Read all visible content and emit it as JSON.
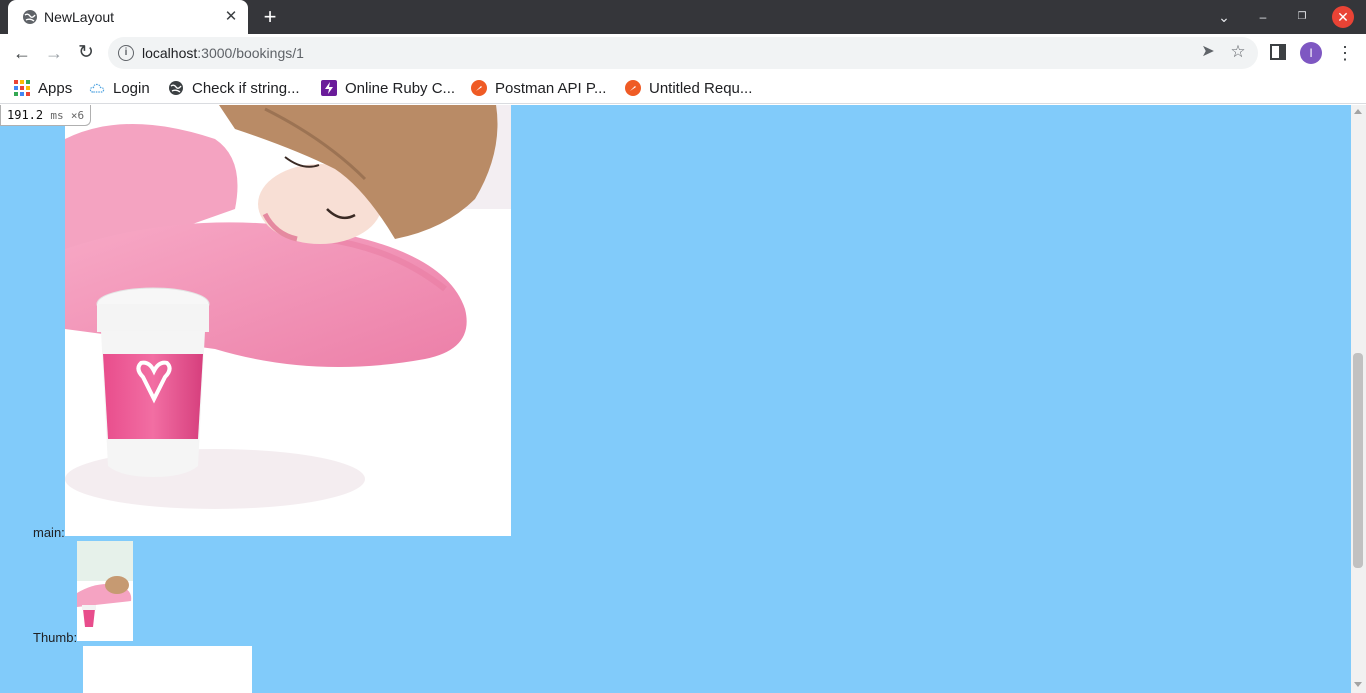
{
  "tab": {
    "title": "NewLayout",
    "close_glyph": "✕",
    "icon": "globe-icon"
  },
  "new_tab_glyph": "+",
  "window_controls": {
    "menu": "⌄",
    "minimize": "–",
    "restore": "❐",
    "close": "✕"
  },
  "toolbar": {
    "back": "←",
    "forward": "→",
    "reload": "↻",
    "url_host": "localhost",
    "url_path": ":3000/bookings/1",
    "send_glyph": "➤",
    "star_glyph": "☆",
    "profile_initial": "I",
    "menu_glyph": "⋮"
  },
  "bookmarks": [
    {
      "label": "Apps",
      "icon": "apps-grid-icon"
    },
    {
      "label": "Login",
      "icon": "cloud-icon"
    },
    {
      "label": "Check if string...",
      "icon": "globe-icon"
    },
    {
      "label": "Online Ruby C...",
      "icon": "bolt-icon"
    },
    {
      "label": "Postman API P...",
      "icon": "postman-icon"
    },
    {
      "label": "Untitled Requ...",
      "icon": "postman-icon"
    }
  ],
  "perf_badge": {
    "value": "191.2",
    "unit": "ms",
    "count": "×6"
  },
  "page": {
    "main_label": "main:",
    "thumb_label": "Thumb:"
  },
  "colors": {
    "page_background": "#81cbfa",
    "tabbar": "#35363a",
    "accent_close": "#e94335",
    "avatar": "#7e57c2"
  }
}
